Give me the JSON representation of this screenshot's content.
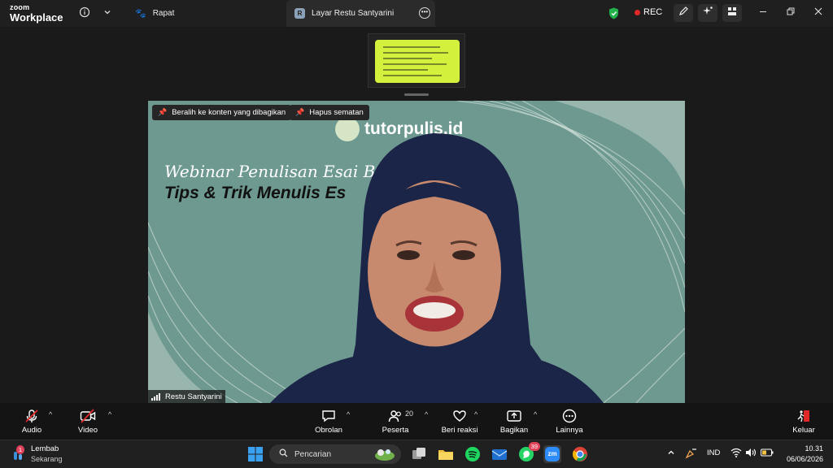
{
  "titlebar": {
    "brand_top": "zoom",
    "brand_bottom": "Workplace",
    "meeting_tab": "Rapat",
    "share_tab_badge": "R",
    "share_tab": "Layar Restu Santyarini",
    "rec_label": "REC"
  },
  "thumbnail": {
    "card_color": "#d3f03c"
  },
  "video": {
    "switch_button": "Beralih ke konten yang dibagikan",
    "unpin_button": "Hapus sematan",
    "brand_text": "tutorpulis.id",
    "headline_1": "Webinar Penulisan Esai Be",
    "headline_2": "Tips & Trik Menulis Es",
    "participant_name": "Restu Santyarini",
    "background_color": "#6e9990"
  },
  "toolbar": {
    "audio": "Audio",
    "video": "Video",
    "chat": "Obrolan",
    "participants": "Peserta",
    "participants_count": "20",
    "reactions": "Beri reaksi",
    "share": "Bagikan",
    "more": "Lainnya",
    "leave": "Keluar",
    "leave_color": "#e02828"
  },
  "taskbar": {
    "weather_badge": "1",
    "weather_title": "Lembab",
    "weather_sub": "Sekarang",
    "search_placeholder": "Pencarian",
    "whatsapp_badge": "39",
    "zoom_app_label": "zm",
    "language": "IND",
    "time": "10.31",
    "date": "06/06/2026"
  }
}
